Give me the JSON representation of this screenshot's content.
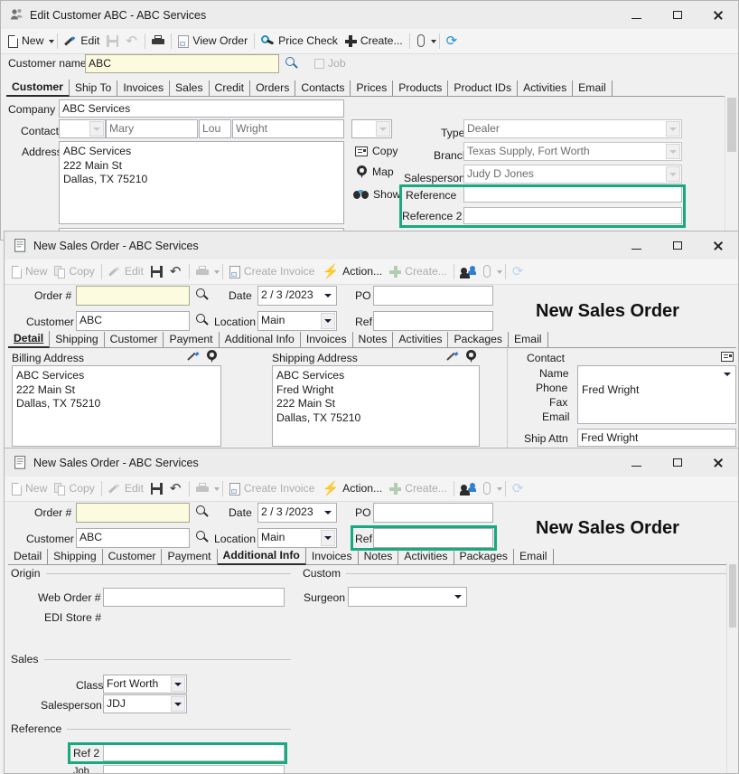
{
  "window1": {
    "title": "Edit Customer ABC - ABC Services",
    "icon": "customer-icon",
    "controls": {
      "minimize": "minimize",
      "maximize": "maximize",
      "close": "close"
    },
    "toolbar": [
      {
        "name": "new",
        "label": "New",
        "icon": "new-document-icon",
        "enabled": true,
        "dropdown": true
      },
      {
        "name": "edit",
        "label": "Edit",
        "icon": "pencil-icon",
        "enabled": true
      },
      {
        "name": "save",
        "label": "",
        "icon": "save-disk-icon",
        "enabled": false
      },
      {
        "name": "undo",
        "label": "",
        "icon": "undo-arrow-icon",
        "enabled": false
      },
      {
        "name": "print",
        "label": "",
        "icon": "printer-icon",
        "enabled": true
      },
      {
        "name": "view-order",
        "label": "View Order",
        "icon": "document-icon",
        "enabled": false
      },
      {
        "name": "price-check",
        "label": "Price Check",
        "icon": "price-check-icon",
        "enabled": true
      },
      {
        "name": "create",
        "label": "Create...",
        "icon": "plus-icon",
        "enabled": true
      },
      {
        "name": "attach",
        "label": "",
        "icon": "paperclip-icon",
        "enabled": true,
        "dropdown": true
      },
      {
        "name": "refresh",
        "label": "",
        "icon": "refresh-icon",
        "enabled": true
      }
    ],
    "customer_name_label": "Customer name",
    "customer_name_value": "ABC",
    "search_icon": "search-icon",
    "job_label": "Job",
    "tabs": [
      "Customer",
      "Ship To",
      "Invoices",
      "Sales",
      "Credit",
      "Orders",
      "Contacts",
      "Prices",
      "Products",
      "Product IDs",
      "Activities",
      "Email"
    ],
    "selected_tab": "Customer",
    "fields": {
      "company_label": "Company",
      "company_value": "ABC Services",
      "contact_label": "Contact",
      "contact_title": "",
      "contact_first": "Mary",
      "contact_middle": "Lou",
      "contact_last": "Wright",
      "address_label": "Address",
      "address_value": "ABC Services\n222 Main St\nDallas, TX 75210"
    },
    "actions": [
      {
        "name": "copy",
        "label": "Copy",
        "icon": "copy-icon"
      },
      {
        "name": "map",
        "label": "Map",
        "icon": "map-pin-icon"
      },
      {
        "name": "show",
        "label": "Show",
        "icon": "binoculars-icon"
      }
    ],
    "right_fields": {
      "type_label": "Type",
      "type_value": "Dealer",
      "branch_label": "Branch",
      "branch_value": "Texas Supply, Fort Worth",
      "salesperson_label": "Salesperson",
      "salesperson_value": "Judy D Jones",
      "reference_label": "Reference",
      "reference_value": "",
      "reference2_label": "Reference 2",
      "reference2_value": ""
    },
    "highlight_color": "#17a97f"
  },
  "window2": {
    "title": "New Sales Order - ABC Services",
    "icon": "sales-order-icon",
    "toolbar": [
      {
        "name": "new",
        "label": "New",
        "icon": "new-document-icon",
        "enabled": false
      },
      {
        "name": "copy",
        "label": "Copy",
        "icon": "copy-icon",
        "enabled": false
      },
      {
        "name": "edit",
        "label": "Edit",
        "icon": "pencil-icon",
        "enabled": false
      },
      {
        "name": "save",
        "label": "",
        "icon": "save-disk-icon",
        "enabled": true
      },
      {
        "name": "undo",
        "label": "",
        "icon": "undo-arrow-icon",
        "enabled": true
      },
      {
        "name": "print",
        "label": "",
        "icon": "printer-icon",
        "enabled": false,
        "dropdown": true
      },
      {
        "name": "create-invoice",
        "label": "Create Invoice",
        "icon": "invoice-icon",
        "enabled": false
      },
      {
        "name": "action",
        "label": "Action...",
        "icon": "lightning-bolt-icon",
        "enabled": true
      },
      {
        "name": "create",
        "label": "Create...",
        "icon": "plus-icon",
        "enabled": false
      },
      {
        "name": "contacts",
        "label": "",
        "icon": "people-icon",
        "enabled": true
      },
      {
        "name": "attach",
        "label": "",
        "icon": "paperclip-icon",
        "enabled": false,
        "dropdown": true
      },
      {
        "name": "refresh",
        "label": "",
        "icon": "refresh-icon",
        "enabled": false
      }
    ],
    "header": {
      "order_label": "Order #",
      "order_value": "",
      "date_label": "Date",
      "date_value": "2 / 3 /2023",
      "po_label": "PO",
      "po_value": "",
      "customer_label": "Customer",
      "customer_value": "ABC",
      "location_label": "Location",
      "location_value": "Main",
      "ref_label": "Ref",
      "ref_value": "",
      "banner": "New Sales Order"
    },
    "tabs": [
      "Detail",
      "Shipping",
      "Customer",
      "Payment",
      "Additional Info",
      "Invoices",
      "Notes",
      "Activities",
      "Packages",
      "Email"
    ],
    "selected_tab": "Detail",
    "billing": {
      "label": "Billing Address",
      "value": "ABC Services\n222 Main St\nDallas, TX 75210"
    },
    "shipping": {
      "label": "Shipping Address",
      "value": "ABC Services\nFred Wright\n222 Main St\nDallas, TX 75210"
    },
    "contact": {
      "label": "Contact",
      "name_label": "Name",
      "name_value": "Fred Wright",
      "phone_label": "Phone",
      "fax_label": "Fax",
      "email_label": "Email",
      "ship_attn_label": "Ship Attn",
      "ship_attn_value": "Fred Wright"
    }
  },
  "window3": {
    "title": "New Sales Order - ABC Services",
    "icon": "sales-order-icon",
    "toolbar": [
      {
        "name": "new",
        "label": "New",
        "icon": "new-document-icon",
        "enabled": false
      },
      {
        "name": "copy",
        "label": "Copy",
        "icon": "copy-icon",
        "enabled": false
      },
      {
        "name": "edit",
        "label": "Edit",
        "icon": "pencil-icon",
        "enabled": false
      },
      {
        "name": "save",
        "label": "",
        "icon": "save-disk-icon",
        "enabled": true
      },
      {
        "name": "undo",
        "label": "",
        "icon": "undo-arrow-icon",
        "enabled": true
      },
      {
        "name": "print",
        "label": "",
        "icon": "printer-icon",
        "enabled": false,
        "dropdown": true
      },
      {
        "name": "create-invoice",
        "label": "Create Invoice",
        "icon": "invoice-icon",
        "enabled": false
      },
      {
        "name": "action",
        "label": "Action...",
        "icon": "lightning-bolt-icon",
        "enabled": true
      },
      {
        "name": "create",
        "label": "Create...",
        "icon": "plus-icon",
        "enabled": false
      },
      {
        "name": "contacts",
        "label": "",
        "icon": "people-icon",
        "enabled": true
      },
      {
        "name": "attach",
        "label": "",
        "icon": "paperclip-icon",
        "enabled": false,
        "dropdown": true
      },
      {
        "name": "refresh",
        "label": "",
        "icon": "refresh-icon",
        "enabled": false
      }
    ],
    "header": {
      "order_label": "Order #",
      "order_value": "",
      "date_label": "Date",
      "date_value": "2 / 3 /2023",
      "po_label": "PO",
      "po_value": "",
      "customer_label": "Customer",
      "customer_value": "ABC",
      "location_label": "Location",
      "location_value": "Main",
      "ref_label": "Ref",
      "ref_value": "",
      "banner": "New Sales Order"
    },
    "tabs": [
      "Detail",
      "Shipping",
      "Customer",
      "Payment",
      "Additional Info",
      "Invoices",
      "Notes",
      "Activities",
      "Packages",
      "Email"
    ],
    "selected_tab": "Additional Info",
    "origin": {
      "section": "Origin",
      "web_order_label": "Web Order #",
      "web_order_value": "",
      "edi_store_label": "EDI Store #"
    },
    "custom": {
      "section": "Custom",
      "surgeon_label": "Surgeon",
      "surgeon_value": ""
    },
    "sales": {
      "section": "Sales",
      "class_label": "Class",
      "class_value": "Fort Worth",
      "salesperson_label": "Salesperson",
      "salesperson_value": "JDJ"
    },
    "reference": {
      "section": "Reference",
      "ref2_label": "Ref 2",
      "ref2_value": ""
    }
  }
}
